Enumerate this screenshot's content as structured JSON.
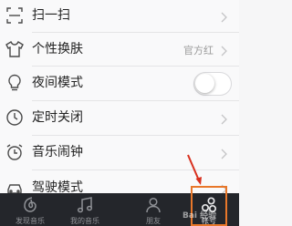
{
  "settings": {
    "items": [
      {
        "label": "扫一扫",
        "icon": "scan-icon"
      },
      {
        "label": "个性换肤",
        "value": "官方红",
        "icon": "shirt-icon"
      },
      {
        "label": "夜间模式",
        "icon": "lightbulb-icon",
        "toggle_on": false
      },
      {
        "label": "定时关闭",
        "icon": "clock-icon"
      },
      {
        "label": "音乐闹钟",
        "icon": "alarm-clock-icon"
      },
      {
        "label": "驾驶模式",
        "icon": "car-icon"
      }
    ]
  },
  "tabbar": {
    "tabs": [
      {
        "label": "发现音乐",
        "icon": "netease-logo-icon"
      },
      {
        "label": "我的音乐",
        "icon": "music-note-icon"
      },
      {
        "label": "朋友",
        "icon": "friends-icon"
      },
      {
        "label": "帐号",
        "icon": "account-icon",
        "selected": true
      }
    ]
  },
  "annotation": {
    "color": "#e8772a"
  },
  "watermark": {
    "text": "Bai 经验"
  },
  "colors": {
    "tabbar_bg": "#24262b",
    "list_bg": "#f9f9fa",
    "accent": "#e8772a"
  }
}
